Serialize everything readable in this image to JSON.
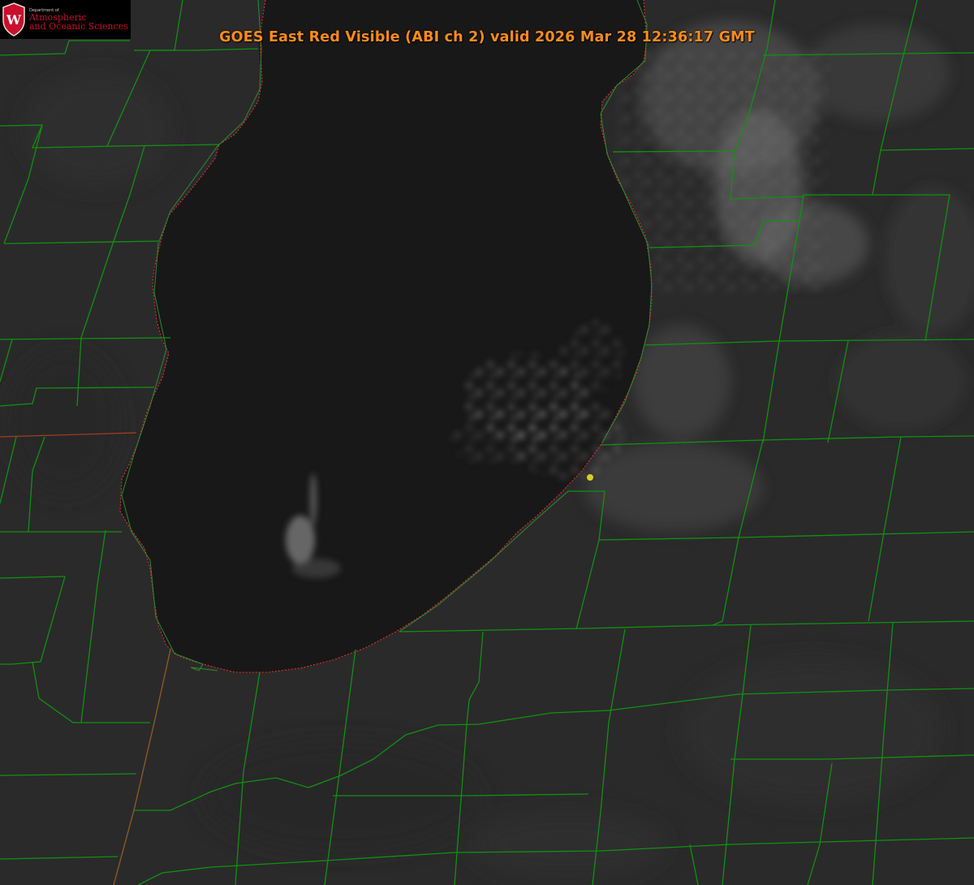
{
  "title": "GOES East Red Visible (ABI ch 2) valid 2026 Mar 28 12:36:17 GMT",
  "logo": {
    "dept": "Department of",
    "line1": "Atmospheric",
    "line2": "and Oceanic Sciences",
    "crest_letter": "W"
  },
  "colors": {
    "land": "#2a2a2a",
    "lake": "#181818",
    "boundary": "#119111",
    "shoreline": "#e03030",
    "title": "#ff8c1a",
    "marker": "#d8d020",
    "logo_red": "#c8102e"
  }
}
